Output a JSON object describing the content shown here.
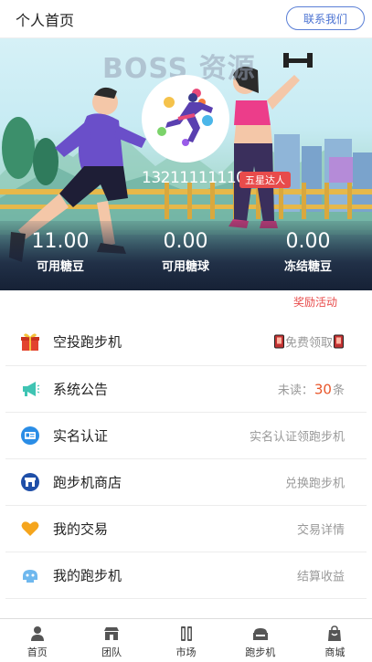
{
  "header": {
    "title": "个人首页",
    "contact_label": "联系我们"
  },
  "banner": {
    "watermark": "BOSS 资源",
    "phone": "13211111110",
    "level": "五星达人",
    "stats": [
      {
        "value": "11.00",
        "label": "可用糖豆"
      },
      {
        "value": "0.00",
        "label": "可用糖球"
      },
      {
        "value": "0.00",
        "label": "冻结糖豆"
      }
    ]
  },
  "reward_link": "奖励活动",
  "menu": [
    {
      "label": "空投跑步机",
      "right": "免费领取",
      "icon": "gift-icon"
    },
    {
      "label": "系统公告",
      "right_prefix": "未读：",
      "right_count": "30",
      "right_suffix": "条",
      "icon": "megaphone-icon"
    },
    {
      "label": "实名认证",
      "right": "实名认证领跑步机",
      "icon": "id-card-icon"
    },
    {
      "label": "跑步机商店",
      "right": "兑换跑步机",
      "icon": "store-icon"
    },
    {
      "label": "我的交易",
      "right": "交易详情",
      "icon": "heart-icon"
    },
    {
      "label": "我的跑步机",
      "right": "结算收益",
      "icon": "machine-icon"
    }
  ],
  "tabbar": [
    {
      "label": "首页",
      "icon": "person-icon"
    },
    {
      "label": "团队",
      "icon": "team-icon"
    },
    {
      "label": "市场",
      "icon": "market-icon"
    },
    {
      "label": "跑步机",
      "icon": "treadmill-icon"
    },
    {
      "label": "商城",
      "icon": "bag-icon"
    }
  ],
  "colors": {
    "accent": "#4a72d2",
    "red": "#e84b4b",
    "unread": "#e8562a"
  }
}
